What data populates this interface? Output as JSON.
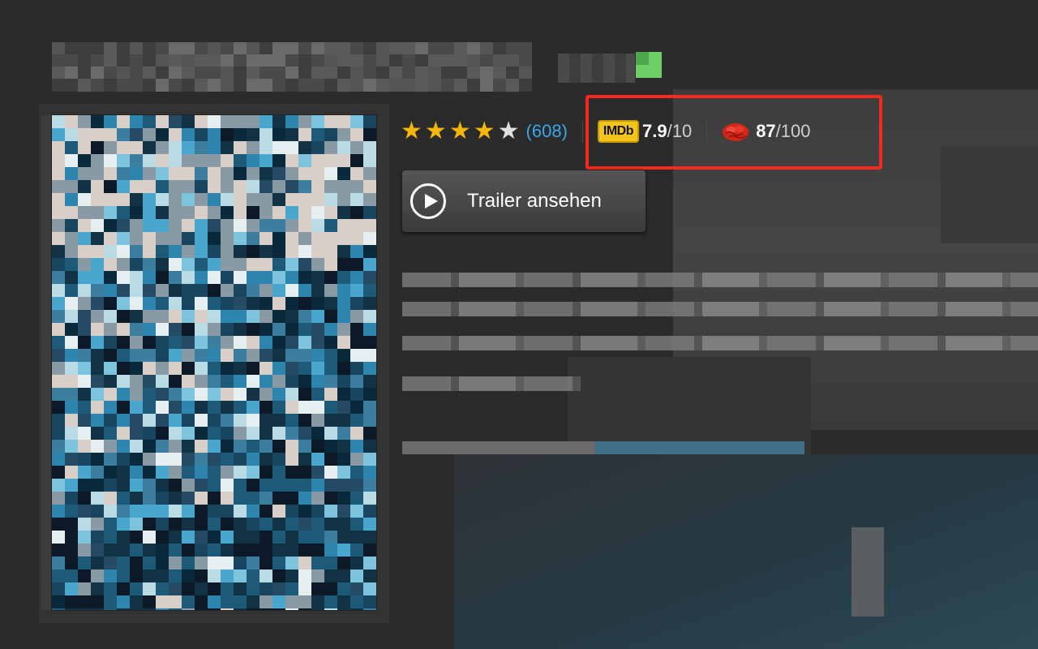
{
  "movie": {
    "ratings": {
      "user_stars": 4,
      "stars_max": 5,
      "vote_count": "(608)",
      "imdb": {
        "logo_text": "IMDb",
        "score": "7.9",
        "max": "/10"
      },
      "metacritic": {
        "score": "87",
        "max": "/100"
      }
    },
    "trailer_button": {
      "label": "Trailer ansehen"
    }
  },
  "colors": {
    "highlight": "#f7281d",
    "star_filled": "#f5b50a",
    "vote_link": "#3aa6e8",
    "imdb_yellow": "#f3c51b"
  }
}
